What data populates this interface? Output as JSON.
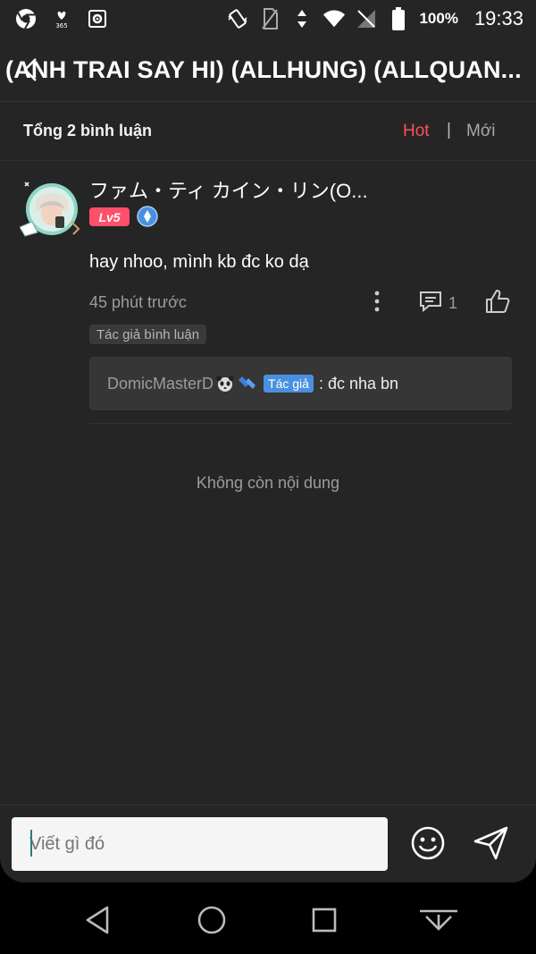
{
  "status_bar": {
    "icons_left": [
      "chrome-icon",
      "health-365-icon",
      "settings-app-icon"
    ],
    "icons_right": [
      "vibrate-icon",
      "no-sim-icon",
      "data-icon",
      "wifi-icon",
      "no-signal-icon",
      "battery-icon"
    ],
    "battery": "100%",
    "time": "19:33"
  },
  "header": {
    "title": "(ANH TRAI SAY HI) (ALLHUNG) (ALLQUAN..."
  },
  "sort": {
    "count_label": "Tổng 2 bình luận",
    "hot_label": "Hot",
    "separator": "|",
    "new_label": "Mới",
    "active_color": "#ff4f5e"
  },
  "comment": {
    "username": "ファム・ティ カイン・リン(O...",
    "level": "Lv5",
    "text": "hay nhoo, mình kb đc ko dạ",
    "time": "45 phút trước",
    "reply_count": "1",
    "author_tag": "Tác giả bình luận",
    "reply": {
      "user": "DomicMasterD",
      "badge": "Tác giả",
      "text": ": đc nha bn"
    }
  },
  "feed": {
    "end_text": "Không còn nội dung"
  },
  "input": {
    "placeholder": "Viết gì đó"
  }
}
